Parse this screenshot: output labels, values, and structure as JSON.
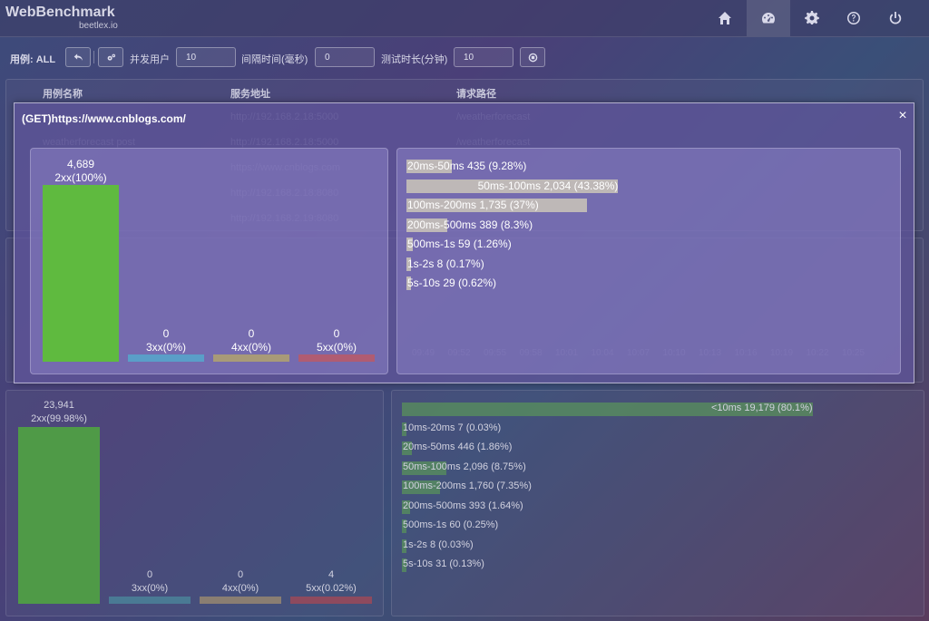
{
  "brand": {
    "title": "WebBenchmark",
    "subtitle": "beetlex.io"
  },
  "nav": [
    {
      "name": "home-icon"
    },
    {
      "name": "dashboard-icon"
    },
    {
      "name": "gear-icon"
    },
    {
      "name": "help-icon"
    },
    {
      "name": "power-icon"
    }
  ],
  "toolbar": {
    "case_label": "用例: ALL",
    "concurrent_label": "并发用户",
    "concurrent_value": "10",
    "interval_label": "间隔时间(毫秒)",
    "interval_value": "0",
    "duration_label": "测试时长(分钟)",
    "duration_value": "10"
  },
  "table": {
    "headers": [
      "用例名称",
      "服务地址",
      "请求路径"
    ],
    "rows": [
      [
        "",
        "http://192.168.2.18:5000",
        "/weatherforecast"
      ],
      [
        "weatherforecast post",
        "http://192.168.2.18:5000",
        "/weatherforecast"
      ],
      [
        "",
        "https://www.cnblogs.com",
        ""
      ],
      [
        "",
        "http://192.168.2.18:8080",
        ""
      ],
      [
        "",
        "http://192.168.2.19:8080",
        ""
      ]
    ]
  },
  "timeline_ticks": [
    "09:49",
    "09:52",
    "09:55",
    "09:58",
    "10:01",
    "10:04",
    "10:07",
    "10:10",
    "10:13",
    "10:16",
    "10:19",
    "10:22",
    "10:25"
  ],
  "modal": {
    "title": "(GET)https://www.cnblogs.com/",
    "close": "×",
    "status": [
      {
        "count": "4,689",
        "label": "2xx(100%)",
        "pct": 100,
        "color": "#5fba3f"
      },
      {
        "count": "0",
        "label": "3xx(0%)",
        "pct": 0,
        "color": "#5a9ec8"
      },
      {
        "count": "0",
        "label": "4xx(0%)",
        "pct": 0,
        "color": "#a89a78"
      },
      {
        "count": "0",
        "label": "5xx(0%)",
        "pct": 0,
        "color": "#b05c72"
      }
    ],
    "ranges": [
      {
        "text": "20ms-50ms 435 (9.28%)",
        "pct": 9.28
      },
      {
        "text": "50ms-100ms 2,034 (43.38%)",
        "pct": 43.38
      },
      {
        "text": "100ms-200ms 1,735 (37%)",
        "pct": 37
      },
      {
        "text": "200ms-500ms 389 (8.3%)",
        "pct": 8.3
      },
      {
        "text": "500ms-1s 59 (1.26%)",
        "pct": 1.26
      },
      {
        "text": "1s-2s 8 (0.17%)",
        "pct": 0.17
      },
      {
        "text": "5s-10s 29 (0.62%)",
        "pct": 0.62
      }
    ]
  },
  "bottom": {
    "status": [
      {
        "count": "23,941",
        "label": "2xx(99.98%)",
        "pct": 99.98,
        "color": "#4f9a47"
      },
      {
        "count": "0",
        "label": "3xx(0%)",
        "pct": 0,
        "color": "#4a7a94"
      },
      {
        "count": "0",
        "label": "4xx(0%)",
        "pct": 0,
        "color": "#8a7e72"
      },
      {
        "count": "4",
        "label": "5xx(0.02%)",
        "pct": 0.02,
        "color": "#8e4a5e"
      }
    ],
    "ranges": [
      {
        "text": "<10ms 19,179 (80.1%)",
        "pct": 80.1
      },
      {
        "text": "10ms-20ms 7 (0.03%)",
        "pct": 0.03
      },
      {
        "text": "20ms-50ms 446 (1.86%)",
        "pct": 1.86
      },
      {
        "text": "50ms-100ms 2,096 (8.75%)",
        "pct": 8.75
      },
      {
        "text": "100ms-200ms 1,760 (7.35%)",
        "pct": 7.35
      },
      {
        "text": "200ms-500ms 393 (1.64%)",
        "pct": 1.64
      },
      {
        "text": "500ms-1s 60 (0.25%)",
        "pct": 0.25
      },
      {
        "text": "1s-2s 8 (0.03%)",
        "pct": 0.03
      },
      {
        "text": "5s-10s 31 (0.13%)",
        "pct": 0.13
      }
    ]
  }
}
